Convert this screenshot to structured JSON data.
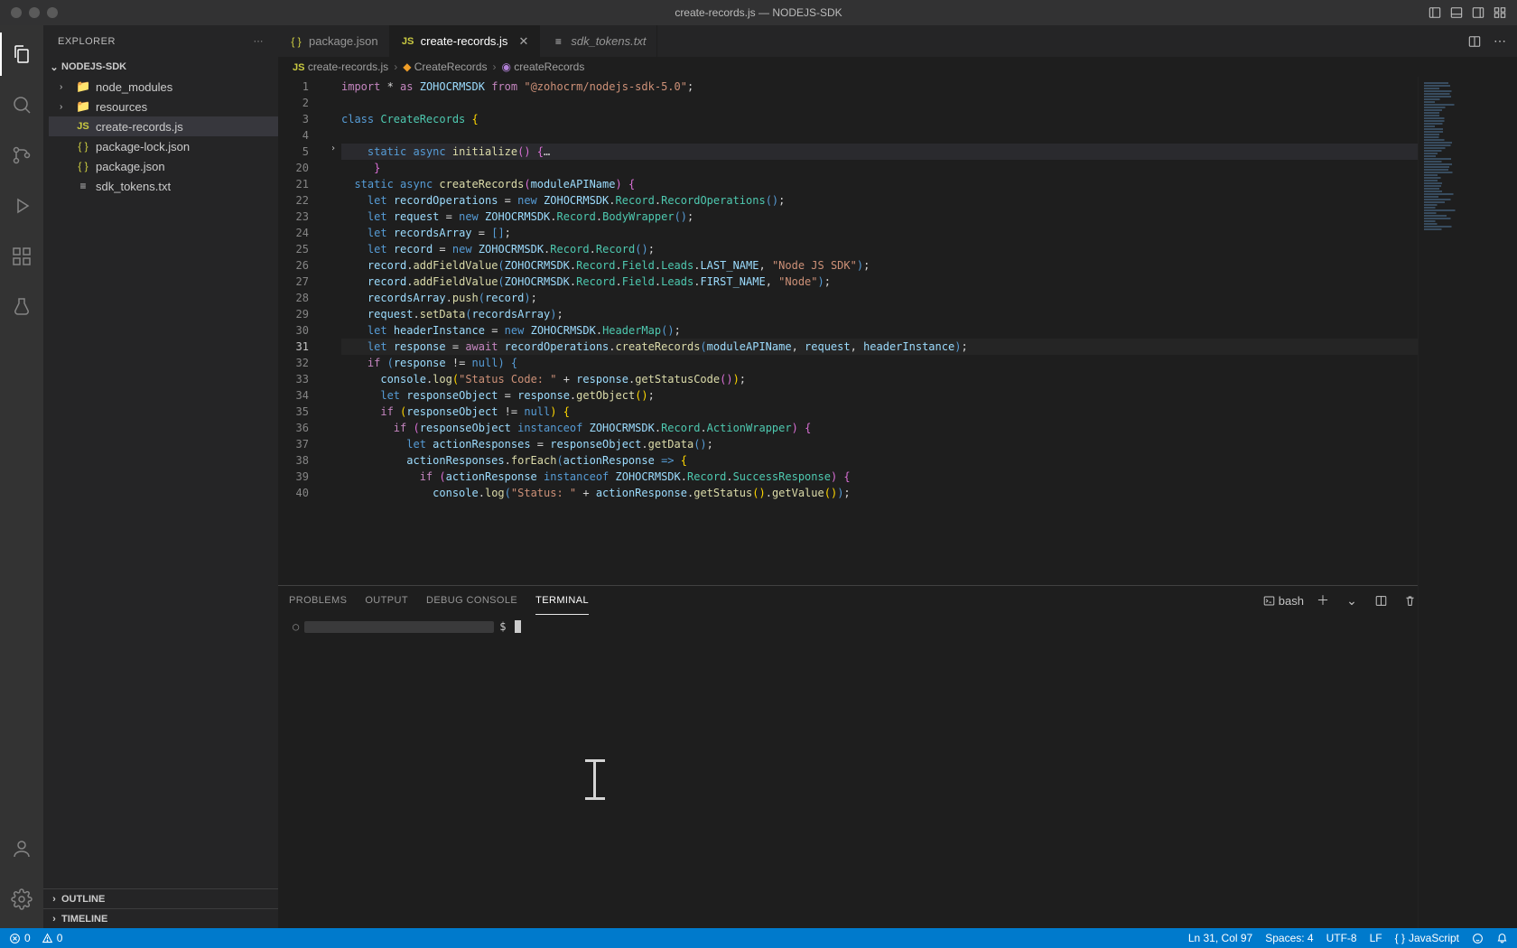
{
  "title": "create-records.js — NODEJS-SDK",
  "sidebar": {
    "header": "EXPLORER",
    "project": "NODEJS-SDK",
    "items": [
      {
        "label": "node_modules",
        "kind": "folder"
      },
      {
        "label": "resources",
        "kind": "folder"
      },
      {
        "label": "create-records.js",
        "kind": "js",
        "selected": true
      },
      {
        "label": "package-lock.json",
        "kind": "json"
      },
      {
        "label": "package.json",
        "kind": "json"
      },
      {
        "label": "sdk_tokens.txt",
        "kind": "txt"
      }
    ],
    "outline": "OUTLINE",
    "timeline": "TIMELINE"
  },
  "tabs": [
    {
      "label": "package.json",
      "kind": "json",
      "active": false
    },
    {
      "label": "create-records.js",
      "kind": "js",
      "active": true,
      "close": true
    },
    {
      "label": "sdk_tokens.txt",
      "kind": "txt",
      "active": false,
      "italic": true
    }
  ],
  "breadcrumbs": [
    {
      "icon": "js",
      "label": "create-records.js"
    },
    {
      "icon": "class",
      "label": "CreateRecords"
    },
    {
      "icon": "method",
      "label": "createRecords"
    }
  ],
  "line_numbers": [
    "1",
    "2",
    "3",
    "4",
    "5",
    "20",
    "21",
    "22",
    "23",
    "24",
    "25",
    "26",
    "27",
    "28",
    "29",
    "30",
    "31",
    "32",
    "33",
    "34",
    "35",
    "36",
    "37",
    "38",
    "39",
    "40"
  ],
  "active_line_index": 16,
  "code_lines": [
    {
      "t": "import * as ZOHOCRMSDK from \"@zohocrm/nodejs-sdk-5.0\";",
      "seg": [
        [
          "kw",
          "import"
        ],
        [
          "op",
          " * "
        ],
        [
          "kw",
          "as"
        ],
        [
          "op",
          " "
        ],
        [
          "var",
          "ZOHOCRMSDK"
        ],
        [
          "op",
          " "
        ],
        [
          "kw",
          "from"
        ],
        [
          "op",
          " "
        ],
        [
          "str",
          "\"@zohocrm/nodejs-sdk-5.0\""
        ],
        [
          "op",
          ";"
        ]
      ]
    },
    {
      "t": "",
      "seg": []
    },
    {
      "t": "class CreateRecords {",
      "seg": [
        [
          "kw2",
          "class"
        ],
        [
          "op",
          " "
        ],
        [
          "cls",
          "CreateRecords"
        ],
        [
          "op",
          " "
        ],
        [
          "par",
          "{"
        ]
      ]
    },
    {
      "t": "",
      "seg": []
    },
    {
      "fold": true,
      "t": "    static async initialize() {…",
      "seg": [
        [
          "op",
          "    "
        ],
        [
          "kw2",
          "static"
        ],
        [
          "op",
          " "
        ],
        [
          "kw2",
          "async"
        ],
        [
          "op",
          " "
        ],
        [
          "fn",
          "initialize"
        ],
        [
          "par2",
          "()"
        ],
        [
          "op",
          " "
        ],
        [
          "par2",
          "{"
        ],
        [
          "op",
          "…"
        ]
      ]
    },
    {
      "t": "     }",
      "seg": [
        [
          "op",
          "     "
        ],
        [
          "par2",
          "}"
        ]
      ]
    },
    {
      "t": "  static async createRecords(moduleAPIName) {",
      "seg": [
        [
          "op",
          "  "
        ],
        [
          "kw2",
          "static"
        ],
        [
          "op",
          " "
        ],
        [
          "kw2",
          "async"
        ],
        [
          "op",
          " "
        ],
        [
          "fn",
          "createRecords"
        ],
        [
          "par2",
          "("
        ],
        [
          "var",
          "moduleAPIName"
        ],
        [
          "par2",
          ")"
        ],
        [
          "op",
          " "
        ],
        [
          "par2",
          "{"
        ]
      ]
    },
    {
      "t": "    let recordOperations = new ZOHOCRMSDK.Record.RecordOperations();",
      "seg": [
        [
          "op",
          "    "
        ],
        [
          "kw2",
          "let"
        ],
        [
          "op",
          " "
        ],
        [
          "var",
          "recordOperations"
        ],
        [
          "op",
          " = "
        ],
        [
          "kw2",
          "new"
        ],
        [
          "op",
          " "
        ],
        [
          "var",
          "ZOHOCRMSDK"
        ],
        [
          "op",
          "."
        ],
        [
          "cls",
          "Record"
        ],
        [
          "op",
          "."
        ],
        [
          "cls",
          "RecordOperations"
        ],
        [
          "par3",
          "()"
        ],
        [
          "op",
          ";"
        ]
      ]
    },
    {
      "t": "    let request = new ZOHOCRMSDK.Record.BodyWrapper();",
      "seg": [
        [
          "op",
          "    "
        ],
        [
          "kw2",
          "let"
        ],
        [
          "op",
          " "
        ],
        [
          "var",
          "request"
        ],
        [
          "op",
          " = "
        ],
        [
          "kw2",
          "new"
        ],
        [
          "op",
          " "
        ],
        [
          "var",
          "ZOHOCRMSDK"
        ],
        [
          "op",
          "."
        ],
        [
          "cls",
          "Record"
        ],
        [
          "op",
          "."
        ],
        [
          "cls",
          "BodyWrapper"
        ],
        [
          "par3",
          "()"
        ],
        [
          "op",
          ";"
        ]
      ]
    },
    {
      "t": "    let recordsArray = [];",
      "seg": [
        [
          "op",
          "    "
        ],
        [
          "kw2",
          "let"
        ],
        [
          "op",
          " "
        ],
        [
          "var",
          "recordsArray"
        ],
        [
          "op",
          " = "
        ],
        [
          "par3",
          "[]"
        ],
        [
          "op",
          ";"
        ]
      ]
    },
    {
      "t": "    let record = new ZOHOCRMSDK.Record.Record();",
      "seg": [
        [
          "op",
          "    "
        ],
        [
          "kw2",
          "let"
        ],
        [
          "op",
          " "
        ],
        [
          "var",
          "record"
        ],
        [
          "op",
          " = "
        ],
        [
          "kw2",
          "new"
        ],
        [
          "op",
          " "
        ],
        [
          "var",
          "ZOHOCRMSDK"
        ],
        [
          "op",
          "."
        ],
        [
          "cls",
          "Record"
        ],
        [
          "op",
          "."
        ],
        [
          "cls",
          "Record"
        ],
        [
          "par3",
          "()"
        ],
        [
          "op",
          ";"
        ]
      ]
    },
    {
      "t": "    record.addFieldValue(ZOHOCRMSDK.Record.Field.Leads.LAST_NAME, \"Node JS SDK\");",
      "seg": [
        [
          "op",
          "    "
        ],
        [
          "var",
          "record"
        ],
        [
          "op",
          "."
        ],
        [
          "fn",
          "addFieldValue"
        ],
        [
          "par3",
          "("
        ],
        [
          "var",
          "ZOHOCRMSDK"
        ],
        [
          "op",
          "."
        ],
        [
          "cls",
          "Record"
        ],
        [
          "op",
          "."
        ],
        [
          "cls",
          "Field"
        ],
        [
          "op",
          "."
        ],
        [
          "cls",
          "Leads"
        ],
        [
          "op",
          "."
        ],
        [
          "var",
          "LAST_NAME"
        ],
        [
          "op",
          ", "
        ],
        [
          "str",
          "\"Node JS SDK\""
        ],
        [
          "par3",
          ")"
        ],
        [
          "op",
          ";"
        ]
      ]
    },
    {
      "t": "    record.addFieldValue(ZOHOCRMSDK.Record.Field.Leads.FIRST_NAME, \"Node\");",
      "seg": [
        [
          "op",
          "    "
        ],
        [
          "var",
          "record"
        ],
        [
          "op",
          "."
        ],
        [
          "fn",
          "addFieldValue"
        ],
        [
          "par3",
          "("
        ],
        [
          "var",
          "ZOHOCRMSDK"
        ],
        [
          "op",
          "."
        ],
        [
          "cls",
          "Record"
        ],
        [
          "op",
          "."
        ],
        [
          "cls",
          "Field"
        ],
        [
          "op",
          "."
        ],
        [
          "cls",
          "Leads"
        ],
        [
          "op",
          "."
        ],
        [
          "var",
          "FIRST_NAME"
        ],
        [
          "op",
          ", "
        ],
        [
          "str",
          "\"Node\""
        ],
        [
          "par3",
          ")"
        ],
        [
          "op",
          ";"
        ]
      ]
    },
    {
      "t": "    recordsArray.push(record);",
      "seg": [
        [
          "op",
          "    "
        ],
        [
          "var",
          "recordsArray"
        ],
        [
          "op",
          "."
        ],
        [
          "fn",
          "push"
        ],
        [
          "par3",
          "("
        ],
        [
          "var",
          "record"
        ],
        [
          "par3",
          ")"
        ],
        [
          "op",
          ";"
        ]
      ]
    },
    {
      "t": "    request.setData(recordsArray);",
      "seg": [
        [
          "op",
          "    "
        ],
        [
          "var",
          "request"
        ],
        [
          "op",
          "."
        ],
        [
          "fn",
          "setData"
        ],
        [
          "par3",
          "("
        ],
        [
          "var",
          "recordsArray"
        ],
        [
          "par3",
          ")"
        ],
        [
          "op",
          ";"
        ]
      ]
    },
    {
      "t": "    let headerInstance = new ZOHOCRMSDK.HeaderMap();",
      "seg": [
        [
          "op",
          "    "
        ],
        [
          "kw2",
          "let"
        ],
        [
          "op",
          " "
        ],
        [
          "var",
          "headerInstance"
        ],
        [
          "op",
          " = "
        ],
        [
          "kw2",
          "new"
        ],
        [
          "op",
          " "
        ],
        [
          "var",
          "ZOHOCRMSDK"
        ],
        [
          "op",
          "."
        ],
        [
          "cls",
          "HeaderMap"
        ],
        [
          "par3",
          "()"
        ],
        [
          "op",
          ";"
        ]
      ]
    },
    {
      "active": true,
      "t": "    let response = await recordOperations.createRecords(moduleAPIName, request, headerInstance);",
      "seg": [
        [
          "op",
          "    "
        ],
        [
          "kw2",
          "let"
        ],
        [
          "op",
          " "
        ],
        [
          "var",
          "response"
        ],
        [
          "op",
          " = "
        ],
        [
          "kw",
          "await"
        ],
        [
          "op",
          " "
        ],
        [
          "var",
          "recordOperations"
        ],
        [
          "op",
          "."
        ],
        [
          "fn",
          "createRecords"
        ],
        [
          "par3",
          "("
        ],
        [
          "var",
          "moduleAPIName"
        ],
        [
          "op",
          ", "
        ],
        [
          "var",
          "request"
        ],
        [
          "op",
          ", "
        ],
        [
          "var",
          "headerInstance"
        ],
        [
          "par3",
          ")"
        ],
        [
          "op",
          ";"
        ]
      ]
    },
    {
      "t": "    if (response != null) {",
      "seg": [
        [
          "op",
          "    "
        ],
        [
          "kw",
          "if"
        ],
        [
          "op",
          " "
        ],
        [
          "par3",
          "("
        ],
        [
          "var",
          "response"
        ],
        [
          "op",
          " != "
        ],
        [
          "kw2",
          "null"
        ],
        [
          "par3",
          ")"
        ],
        [
          "op",
          " "
        ],
        [
          "par3",
          "{"
        ]
      ]
    },
    {
      "t": "      console.log(\"Status Code: \" + response.getStatusCode());",
      "seg": [
        [
          "op",
          "      "
        ],
        [
          "var",
          "console"
        ],
        [
          "op",
          "."
        ],
        [
          "fn",
          "log"
        ],
        [
          "par",
          "("
        ],
        [
          "str",
          "\"Status Code: \""
        ],
        [
          "op",
          " + "
        ],
        [
          "var",
          "response"
        ],
        [
          "op",
          "."
        ],
        [
          "fn",
          "getStatusCode"
        ],
        [
          "par2",
          "()"
        ],
        [
          "par",
          ")"
        ],
        [
          "op",
          ";"
        ]
      ]
    },
    {
      "t": "      let responseObject = response.getObject();",
      "seg": [
        [
          "op",
          "      "
        ],
        [
          "kw2",
          "let"
        ],
        [
          "op",
          " "
        ],
        [
          "var",
          "responseObject"
        ],
        [
          "op",
          " = "
        ],
        [
          "var",
          "response"
        ],
        [
          "op",
          "."
        ],
        [
          "fn",
          "getObject"
        ],
        [
          "par",
          "()"
        ],
        [
          "op",
          ";"
        ]
      ]
    },
    {
      "t": "      if (responseObject != null) {",
      "seg": [
        [
          "op",
          "      "
        ],
        [
          "kw",
          "if"
        ],
        [
          "op",
          " "
        ],
        [
          "par",
          "("
        ],
        [
          "var",
          "responseObject"
        ],
        [
          "op",
          " != "
        ],
        [
          "kw2",
          "null"
        ],
        [
          "par",
          ")"
        ],
        [
          "op",
          " "
        ],
        [
          "par",
          "{"
        ]
      ]
    },
    {
      "t": "        if (responseObject instanceof ZOHOCRMSDK.Record.ActionWrapper) {",
      "seg": [
        [
          "op",
          "        "
        ],
        [
          "kw",
          "if"
        ],
        [
          "op",
          " "
        ],
        [
          "par2",
          "("
        ],
        [
          "var",
          "responseObject"
        ],
        [
          "op",
          " "
        ],
        [
          "kw2",
          "instanceof"
        ],
        [
          "op",
          " "
        ],
        [
          "var",
          "ZOHOCRMSDK"
        ],
        [
          "op",
          "."
        ],
        [
          "cls",
          "Record"
        ],
        [
          "op",
          "."
        ],
        [
          "cls",
          "ActionWrapper"
        ],
        [
          "par2",
          ")"
        ],
        [
          "op",
          " "
        ],
        [
          "par2",
          "{"
        ]
      ]
    },
    {
      "t": "          let actionResponses = responseObject.getData();",
      "seg": [
        [
          "op",
          "          "
        ],
        [
          "kw2",
          "let"
        ],
        [
          "op",
          " "
        ],
        [
          "var",
          "actionResponses"
        ],
        [
          "op",
          " = "
        ],
        [
          "var",
          "responseObject"
        ],
        [
          "op",
          "."
        ],
        [
          "fn",
          "getData"
        ],
        [
          "par3",
          "()"
        ],
        [
          "op",
          ";"
        ]
      ]
    },
    {
      "t": "          actionResponses.forEach(actionResponse => {",
      "seg": [
        [
          "op",
          "          "
        ],
        [
          "var",
          "actionResponses"
        ],
        [
          "op",
          "."
        ],
        [
          "fn",
          "forEach"
        ],
        [
          "par3",
          "("
        ],
        [
          "var",
          "actionResponse"
        ],
        [
          "op",
          " "
        ],
        [
          "kw2",
          "=>"
        ],
        [
          "op",
          " "
        ],
        [
          "par",
          "{"
        ]
      ]
    },
    {
      "t": "            if (actionResponse instanceof ZOHOCRMSDK.Record.SuccessResponse) {",
      "seg": [
        [
          "op",
          "            "
        ],
        [
          "kw",
          "if"
        ],
        [
          "op",
          " "
        ],
        [
          "par2",
          "("
        ],
        [
          "var",
          "actionResponse"
        ],
        [
          "op",
          " "
        ],
        [
          "kw2",
          "instanceof"
        ],
        [
          "op",
          " "
        ],
        [
          "var",
          "ZOHOCRMSDK"
        ],
        [
          "op",
          "."
        ],
        [
          "cls",
          "Record"
        ],
        [
          "op",
          "."
        ],
        [
          "cls",
          "SuccessResponse"
        ],
        [
          "par2",
          ")"
        ],
        [
          "op",
          " "
        ],
        [
          "par2",
          "{"
        ]
      ]
    },
    {
      "t": "              console.log(\"Status: \" + actionResponse.getStatus().getValue());",
      "seg": [
        [
          "op",
          "              "
        ],
        [
          "var",
          "console"
        ],
        [
          "op",
          "."
        ],
        [
          "fn",
          "log"
        ],
        [
          "par3",
          "("
        ],
        [
          "str",
          "\"Status: \""
        ],
        [
          "op",
          " + "
        ],
        [
          "var",
          "actionResponse"
        ],
        [
          "op",
          "."
        ],
        [
          "fn",
          "getStatus"
        ],
        [
          "par",
          "()"
        ],
        [
          "op",
          "."
        ],
        [
          "fn",
          "getValue"
        ],
        [
          "par",
          "()"
        ],
        [
          "par3",
          ")"
        ],
        [
          "op",
          ";"
        ]
      ]
    }
  ],
  "panel": {
    "tabs": [
      "PROBLEMS",
      "OUTPUT",
      "DEBUG CONSOLE",
      "TERMINAL"
    ],
    "active": 3,
    "shell": "bash",
    "prompt": "$"
  },
  "status": {
    "errors": "0",
    "warnings": "0",
    "pos": "Ln 31, Col 97",
    "spaces": "Spaces: 4",
    "encoding": "UTF-8",
    "eol": "LF",
    "lang": "JavaScript"
  }
}
